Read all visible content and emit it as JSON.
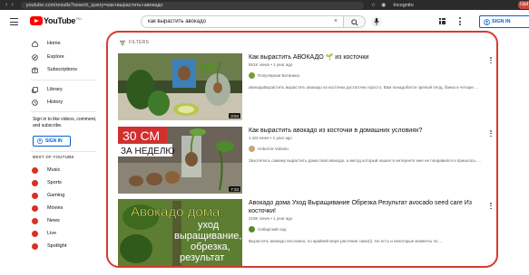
{
  "browser": {
    "url": "youtube.com/results?search_query=как+вырастить+авокадо",
    "incognito_label": "Incognito",
    "update_label": "Upd"
  },
  "header": {
    "logo_text": "YouTube",
    "logo_country": "RU",
    "search_value": "как вырастить авокадо",
    "clear_symbol": "×",
    "sign_in_label": "SIGN IN"
  },
  "sidebar": {
    "items": [
      {
        "label": "Home",
        "icon": "home-icon"
      },
      {
        "label": "Explore",
        "icon": "compass-icon"
      },
      {
        "label": "Subscriptions",
        "icon": "subscriptions-icon"
      },
      {
        "label": "Library",
        "icon": "library-icon"
      },
      {
        "label": "History",
        "icon": "history-icon"
      }
    ],
    "signin_note": "Sign in to like videos, comment, and subscribe.",
    "signin_label": "SIGN IN",
    "best_heading": "BEST OF YOUTUBE",
    "best_items": [
      {
        "label": "Music",
        "icon": "music-icon"
      },
      {
        "label": "Sports",
        "icon": "sports-icon"
      },
      {
        "label": "Gaming",
        "icon": "gaming-icon"
      },
      {
        "label": "Movies",
        "icon": "movies-icon"
      },
      {
        "label": "News",
        "icon": "news-icon"
      },
      {
        "label": "Live",
        "icon": "live-icon"
      },
      {
        "label": "Spotlight",
        "icon": "spotlight-icon"
      }
    ]
  },
  "filters": {
    "label": "FILTERS"
  },
  "results": [
    {
      "title": "Как вырастить АВОКАДО 🌱 из косточки",
      "meta": "561K views • 1 year ago",
      "channel": "Популярная Ботаника",
      "snippet": "авокадоВырастить вырастить авокадо из косточки достаточно просто. Вам понадобится зрелый плод, банка и четыре ...",
      "duration": "3:04"
    },
    {
      "title": "Как вырастить авокадо из косточки в домашних условиях?",
      "meta": "1.1M views • 1 year ago",
      "channel": "Hobo/Air-Videsto",
      "snippet": "Захотелось самому вырастить дома свой авокадо, а метод который нашел в интернете мне не понравился и пришлось ...",
      "duration": "7:33",
      "overlay_line1": "30 СМ",
      "overlay_line2": "ЗА НЕДЕЛЮ"
    },
    {
      "title": "Авокадо дома Уход Выращивание Обрезка Результат avocado seed care Из косточки!",
      "meta": "219K views • 1 year ago",
      "channel": "Сибирский сад",
      "snippet": "Вырастить авокадо несложно, по крайней мере растение само(!). Но есть и некоторые моменты по ...",
      "overlay_line1": "Авокадо дома:",
      "overlay_line2": "уход",
      "overlay_line3": "выращивание,",
      "overlay_line4": "обрезка,",
      "overlay_line5": "результат"
    }
  ],
  "colors": {
    "accent_blue": "#065fd4",
    "youtube_red": "#ff0000",
    "highlight_border": "#d83a30"
  }
}
